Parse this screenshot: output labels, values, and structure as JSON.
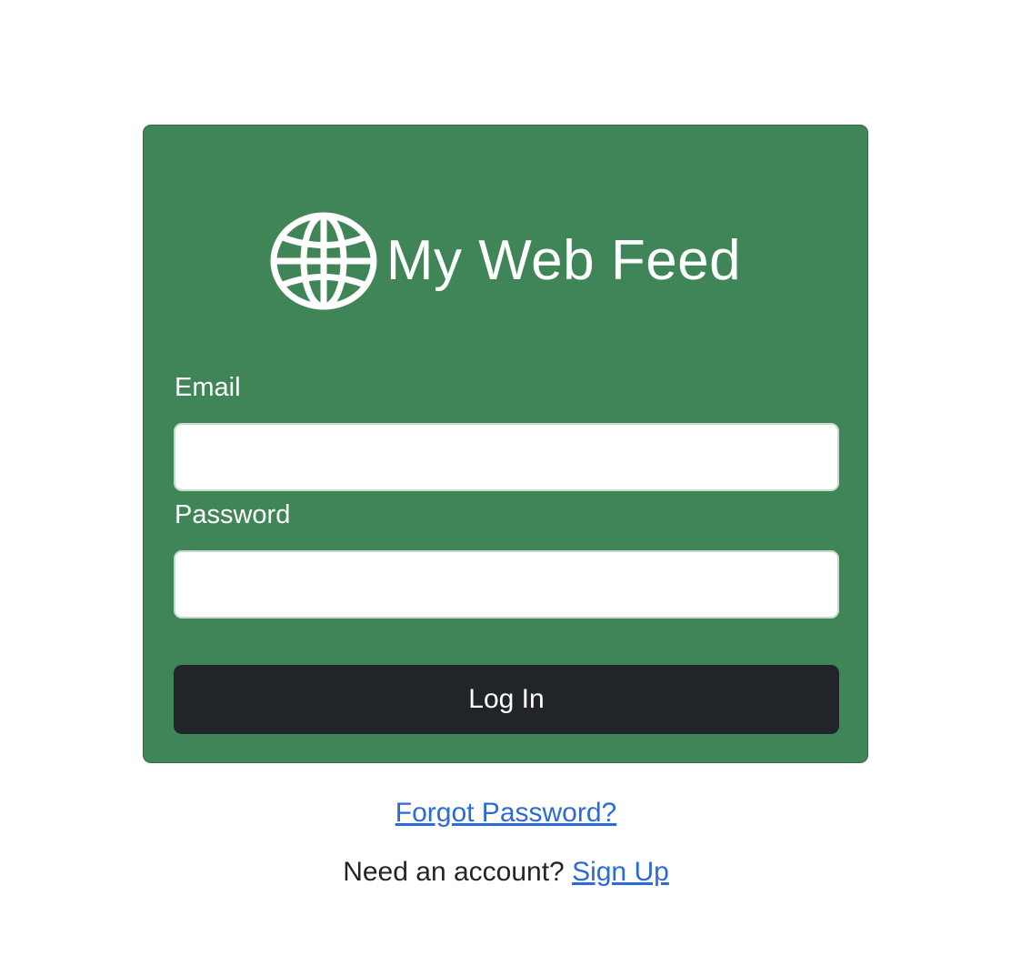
{
  "brand": {
    "title": "My Web Feed",
    "icon": "globe-icon"
  },
  "form": {
    "email_label": "Email",
    "email_value": "",
    "password_label": "Password",
    "password_value": "",
    "submit_label": "Log In"
  },
  "links": {
    "forgot_password": "Forgot Password?",
    "need_account": "Need an account?",
    "sign_up": "Sign Up"
  },
  "colors": {
    "card_background": "#408558",
    "button_background": "#212529",
    "link": "#2c6ad8"
  }
}
